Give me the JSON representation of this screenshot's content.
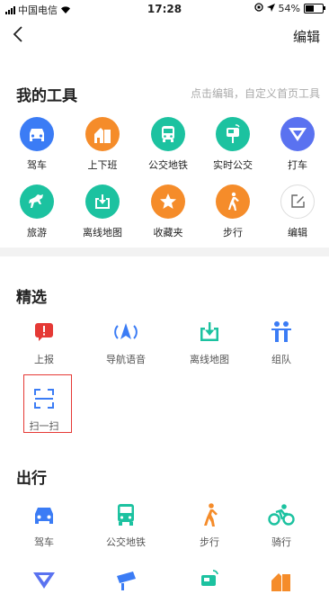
{
  "status": {
    "carrier": "中国电信",
    "time": "17:28",
    "battery": "54%"
  },
  "header": {
    "edit_label": "编辑"
  },
  "my_tools": {
    "title": "我的工具",
    "hint": "点击编辑，自定义首页工具",
    "items": [
      {
        "label": "驾车",
        "icon": "car-icon",
        "color": "#3b7cf5"
      },
      {
        "label": "上下班",
        "icon": "home-office-icon",
        "color": "#f58c2a"
      },
      {
        "label": "公交地铁",
        "icon": "bus-icon",
        "color": "#1cc2a0"
      },
      {
        "label": "实时公交",
        "icon": "bus-stop-icon",
        "color": "#1cc2a0"
      },
      {
        "label": "打车",
        "icon": "taxi-icon",
        "color": "#5a72f0"
      },
      {
        "label": "旅游",
        "icon": "horse-icon",
        "color": "#1cc2a0"
      },
      {
        "label": "离线地图",
        "icon": "offline-map-icon",
        "color": "#1cc2a0"
      },
      {
        "label": "收藏夹",
        "icon": "star-icon",
        "color": "#f58c2a"
      },
      {
        "label": "步行",
        "icon": "walk-icon",
        "color": "#f58c2a"
      },
      {
        "label": "编辑",
        "icon": "edit-icon",
        "color": "#ffffff"
      }
    ]
  },
  "featured": {
    "title": "精选",
    "items": [
      {
        "label": "上报",
        "icon": "report-icon",
        "color": "#e53935"
      },
      {
        "label": "导航语音",
        "icon": "navigation-voice-icon",
        "color": "#3b7cf5"
      },
      {
        "label": "离线地图",
        "icon": "offline-map-icon",
        "color": "#1cc2a0"
      },
      {
        "label": "组队",
        "icon": "team-icon",
        "color": "#3b7cf5"
      },
      {
        "label": "扫一扫",
        "icon": "scan-icon",
        "color": "#3b7cf5"
      }
    ]
  },
  "travel": {
    "title": "出行",
    "items": [
      {
        "label": "驾车",
        "icon": "car-icon",
        "color": "#3b7cf5"
      },
      {
        "label": "公交地铁",
        "icon": "bus-icon",
        "color": "#1cc2a0"
      },
      {
        "label": "步行",
        "icon": "walk-icon",
        "color": "#f58c2a"
      },
      {
        "label": "骑行",
        "icon": "bike-icon",
        "color": "#1cc2a0"
      }
    ]
  }
}
